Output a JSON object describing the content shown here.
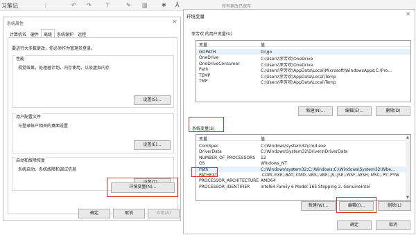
{
  "app": {
    "title": "习笔记",
    "saved_status": "所有更改已保存"
  },
  "toolbar": {
    "icons": [
      "more-icon",
      "undo-icon",
      "redo-icon",
      "format-icon",
      "pen-icon",
      "highlight-icon",
      "magic-icon",
      "text-icon"
    ]
  },
  "system_properties": {
    "title": "系统属性",
    "tabs": [
      "计算机名",
      "硬件",
      "高级",
      "系统保护",
      "远程"
    ],
    "active_tab": "高级",
    "admin_note": "要进行大多数更改，你必须作为管理员登录。",
    "performance": {
      "label": "性能",
      "desc": "视觉效果，处理器计划，内存使用，以及虚拟内存",
      "button": "设置(S)..."
    },
    "user_profile": {
      "label": "用户配置文件",
      "desc": "与登录帐户相关的桌面设置",
      "button": "设置(E)..."
    },
    "startup_recovery": {
      "label": "启动和故障恢复",
      "desc": "系统启动、系统故障和调试信息",
      "button": "设置(T)..."
    },
    "env_button": "环境变量(N)...",
    "ok": "确定",
    "cancel": "取消",
    "apply": "应用(A)"
  },
  "env_vars": {
    "title": "环境变量",
    "user_section": "李芳欢 的用户变量(U)",
    "system_section": "系统变量(S)",
    "col_var": "变量",
    "col_val": "值",
    "user_vars": [
      {
        "name": "GOPATH",
        "value": "D:\\go"
      },
      {
        "name": "OneDrive",
        "value": "C:\\Users\\李芳欢\\OneDrive"
      },
      {
        "name": "OneDriveConsumer",
        "value": "C:\\Users\\李芳欢\\OneDrive"
      },
      {
        "name": "Path",
        "value": "C:\\Users\\李芳欢\\AppData\\Local\\Microsoft\\WindowsApps;C:\\Pro..."
      },
      {
        "name": "TEMP",
        "value": "C:\\Users\\李芳欢\\AppData\\Local\\Temp"
      },
      {
        "name": "TMP",
        "value": "C:\\Users\\李芳欢\\AppData\\Local\\Temp"
      }
    ],
    "system_vars": [
      {
        "name": "ComSpec",
        "value": "C:\\Windows\\system32\\cmd.exe"
      },
      {
        "name": "DriverData",
        "value": "C:\\Windows\\System32\\Drivers\\DriverData"
      },
      {
        "name": "NUMBER_OF_PROCESSORS",
        "value": "12"
      },
      {
        "name": "OS",
        "value": "Windows_NT"
      },
      {
        "name": "Path",
        "value": "C:\\Windows\\system32;C:\\Windows;C:\\Windows\\System32\\Wbe..."
      },
      {
        "name": "PATHEXT",
        "value": ".COM;.EXE;.BAT;.CMD;.VBS;.VBE;.JS;.JSE;.WSF;.WSH;.MSC;.PY;.PYW"
      },
      {
        "name": "PROCESSOR_ARCHITECTURE",
        "value": "AMD64"
      },
      {
        "name": "PROCESSOR_IDENTIFIER",
        "value": "Intel64 Family 6 Model 165 Stepping 2, GenuineIntel"
      }
    ],
    "user_buttons": {
      "new": "新建(N)...",
      "edit": "编辑(E)...",
      "delete": "删除(D)"
    },
    "system_buttons": {
      "new": "新建(W)...",
      "edit": "编辑(I)...",
      "delete": "删除(L)"
    },
    "ok": "确定",
    "cancel": "取消"
  },
  "colors": {
    "highlight": "#e03030",
    "selection": "#e5f1fb"
  }
}
